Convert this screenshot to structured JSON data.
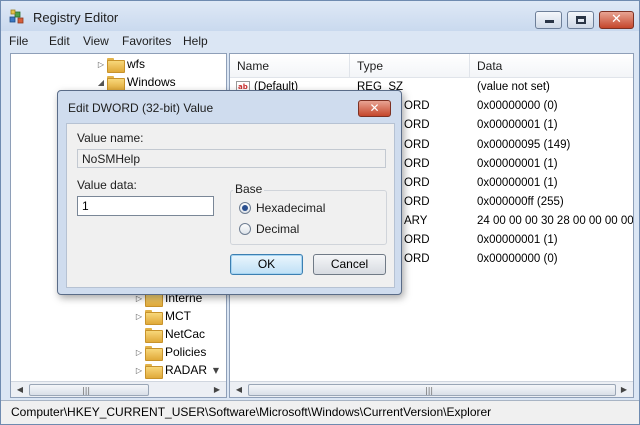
{
  "window": {
    "title": "Registry Editor",
    "close_glyph": "✕"
  },
  "menu": [
    "File",
    "Edit",
    "View",
    "Favorites",
    "Help"
  ],
  "tree": {
    "items_top": [
      {
        "label": "wfs",
        "arrow": "▷"
      },
      {
        "label": "Windows",
        "arrow": "◢"
      }
    ],
    "items_bottom": [
      {
        "label": "Interne",
        "arrow": "▷"
      },
      {
        "label": "MCT",
        "arrow": "▷"
      },
      {
        "label": "NetCac",
        "arrow": ""
      },
      {
        "label": "Policies",
        "arrow": "▷"
      },
      {
        "label": "RADAR",
        "arrow": "▷"
      }
    ]
  },
  "list": {
    "columns": [
      "Name",
      "Type",
      "Data"
    ],
    "rows": [
      {
        "name": "(Default)",
        "type": "REG_SZ",
        "data": "(value not set)"
      },
      {
        "name": "",
        "type": "ORD",
        "data": "0x00000000 (0)"
      },
      {
        "name": "",
        "type": "ORD",
        "data": "0x00000001 (1)"
      },
      {
        "name": "",
        "type": "ORD",
        "data": "0x00000095 (149)"
      },
      {
        "name": "",
        "type": "ORD",
        "data": "0x00000001 (1)"
      },
      {
        "name": "",
        "type": "ORD",
        "data": "0x00000001 (1)"
      },
      {
        "name": "",
        "type": "ORD",
        "data": "0x000000ff (255)"
      },
      {
        "name": "",
        "type": "ARY",
        "data": "24 00 00 00 30 28 00 00 00 00 0"
      },
      {
        "name": "",
        "type": "ORD",
        "data": "0x00000001 (1)"
      },
      {
        "name": "",
        "type": "ORD",
        "data": "0x00000000 (0)"
      }
    ]
  },
  "status": {
    "path": "Computer\\HKEY_CURRENT_USER\\Software\\Microsoft\\Windows\\CurrentVersion\\Explorer"
  },
  "dialog": {
    "title": "Edit DWORD (32-bit) Value",
    "value_name_label": "Value name:",
    "value_name": "NoSMHelp",
    "value_data_label": "Value data:",
    "value_data": "1",
    "base_label": "Base",
    "hex_label": "Hexadecimal",
    "dec_label": "Decimal",
    "selected_base": "Hexadecimal",
    "ok_label": "OK",
    "cancel_label": "Cancel"
  },
  "colors": {
    "window_frame": "#dbe6f4",
    "close_red": "#c5462b",
    "default_button": "#bfe0f6"
  },
  "icons": [
    "registry-editor-icon",
    "folder-icon",
    "string-value-icon",
    "minimize-icon",
    "maximize-icon",
    "close-icon"
  ]
}
